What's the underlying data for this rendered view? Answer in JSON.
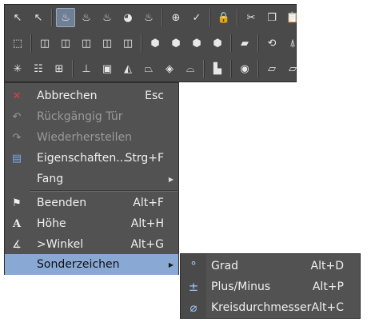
{
  "toolbar": {
    "row1": [
      {
        "icon": "cursor-arrow-icon",
        "glyph": "↖",
        "active": false
      },
      {
        "icon": "pick-arrow-icon",
        "glyph": "↖",
        "active": false
      },
      {
        "sep": true
      },
      {
        "icon": "bathtub-view-icon",
        "glyph": "♨",
        "active": true
      },
      {
        "icon": "bathtub-outline-icon",
        "glyph": "♨",
        "active": false
      },
      {
        "icon": "bathtub-render-icon",
        "glyph": "♨",
        "active": false
      },
      {
        "icon": "color-wheel-icon",
        "glyph": "◕",
        "active": false
      },
      {
        "icon": "bathtub-yellow-icon",
        "glyph": "♨",
        "active": false
      },
      {
        "sep": true
      },
      {
        "icon": "zoom-icon",
        "glyph": "⊕",
        "active": false
      },
      {
        "icon": "check-pen-icon",
        "glyph": "✓",
        "active": false
      },
      {
        "sep": true
      },
      {
        "icon": "lock-icon",
        "glyph": "🔒",
        "active": false
      },
      {
        "sep": true
      },
      {
        "icon": "cut-icon",
        "glyph": "✂",
        "active": false
      },
      {
        "icon": "copy-icon",
        "glyph": "❐",
        "active": false
      },
      {
        "icon": "paste-icon",
        "glyph": "📋",
        "active": false
      }
    ],
    "row2": [
      {
        "icon": "cube-axes-icon",
        "glyph": "⬚",
        "active": false
      },
      {
        "sep": true
      },
      {
        "icon": "cube-front-icon",
        "glyph": "◫",
        "active": false
      },
      {
        "icon": "cube-right-icon",
        "glyph": "◫",
        "active": false
      },
      {
        "icon": "cube-back-icon",
        "glyph": "◫",
        "active": false
      },
      {
        "icon": "cube-left-icon",
        "glyph": "◫",
        "active": false
      },
      {
        "icon": "cube-top-icon",
        "glyph": "◫",
        "active": false
      },
      {
        "sep": true
      },
      {
        "icon": "iso-cube-1-icon",
        "glyph": "⬢",
        "active": false
      },
      {
        "icon": "iso-cube-2-icon",
        "glyph": "⬢",
        "active": false
      },
      {
        "icon": "iso-cube-3-icon",
        "glyph": "⬢",
        "active": false
      },
      {
        "icon": "iso-cube-4-icon",
        "glyph": "⬢",
        "active": false
      },
      {
        "sep": true
      },
      {
        "icon": "plane-icon",
        "glyph": "▰",
        "active": false
      },
      {
        "sep": true
      },
      {
        "icon": "rotate-view-icon",
        "glyph": "⟲",
        "active": false
      },
      {
        "icon": "person-view-icon",
        "glyph": "⍋",
        "active": false
      }
    ],
    "row3": [
      {
        "icon": "sun-light-icon",
        "glyph": "✳",
        "active": false
      },
      {
        "icon": "stair-icon",
        "glyph": "☷",
        "active": false
      },
      {
        "icon": "grid-icon",
        "glyph": "⊞",
        "active": false
      },
      {
        "sep": true
      },
      {
        "icon": "layer-1-icon",
        "glyph": "⊥",
        "active": false
      },
      {
        "icon": "layer-2-icon",
        "glyph": "▣",
        "active": false
      },
      {
        "icon": "terrain-icon",
        "glyph": "◭",
        "active": false
      },
      {
        "icon": "slope-icon",
        "glyph": "⏢",
        "active": false
      },
      {
        "icon": "roof-icon",
        "glyph": "◈",
        "active": false
      },
      {
        "icon": "folder-open-icon",
        "glyph": "⌓",
        "active": false
      },
      {
        "sep": true
      },
      {
        "icon": "box-icon",
        "glyph": "▙",
        "active": false
      },
      {
        "sep": true
      },
      {
        "icon": "target-icon",
        "glyph": "◉",
        "active": false
      },
      {
        "sep": true
      },
      {
        "icon": "surface-icon",
        "glyph": "⏥",
        "active": false
      },
      {
        "icon": "surface-edit-icon",
        "glyph": "⏥",
        "active": false
      }
    ]
  },
  "menu": {
    "items": [
      {
        "name": "abbrechen",
        "icon": "cancel-x-icon",
        "glyph": "✕",
        "glyph_color": "#e04040",
        "label": "Abbrechen",
        "shortcut": "Esc",
        "disabled": false,
        "arrow": false,
        "highlight": false
      },
      {
        "name": "rueckgaengig",
        "icon": "undo-icon",
        "glyph": "↶",
        "glyph_color": "#9a9a9a",
        "label": "Rückgängig Tür",
        "shortcut": "",
        "disabled": true,
        "arrow": false,
        "highlight": false
      },
      {
        "name": "wiederherstellen",
        "icon": "redo-icon",
        "glyph": "↷",
        "glyph_color": "#9a9a9a",
        "label": "Wiederherstellen",
        "shortcut": "",
        "disabled": true,
        "arrow": false,
        "highlight": false
      },
      {
        "name": "eigenschaften",
        "icon": "properties-icon",
        "glyph": "▤",
        "glyph_color": "#7aa7e8",
        "label": "Eigenschaften...",
        "shortcut": "Strg+F",
        "disabled": false,
        "arrow": false,
        "highlight": false
      },
      {
        "name": "fang",
        "icon": "",
        "glyph": "",
        "glyph_color": "#ffffff",
        "label": "Fang",
        "shortcut": "",
        "disabled": false,
        "arrow": true,
        "highlight": false
      },
      {
        "name": "beenden",
        "icon": "finish-flag-icon",
        "glyph": "⚑",
        "glyph_color": "#f0f0f0",
        "label": "Beenden",
        "shortcut": "Alt+F",
        "disabled": false,
        "arrow": false,
        "highlight": false
      },
      {
        "name": "hoehe",
        "icon": "height-icon",
        "glyph": "A",
        "glyph_color": "#f0f0f0",
        "label": "Höhe",
        "shortcut": "Alt+H",
        "disabled": false,
        "arrow": false,
        "highlight": false
      },
      {
        "name": "winkel",
        "icon": "angle-icon",
        "glyph": "∡",
        "glyph_color": "#f0f0f0",
        "label": ">Winkel",
        "shortcut": "Alt+G",
        "disabled": false,
        "arrow": false,
        "highlight": false
      },
      {
        "name": "sonderzeichen",
        "icon": "",
        "glyph": "",
        "glyph_color": "#ffffff",
        "label": "Sonderzeichen",
        "shortcut": "",
        "disabled": false,
        "arrow": true,
        "highlight": true
      }
    ]
  },
  "submenu": {
    "items": [
      {
        "name": "grad",
        "icon": "degree-icon",
        "glyph": "°",
        "label": "Grad",
        "shortcut": "Alt+D"
      },
      {
        "name": "plus-minus",
        "icon": "plus-minus-icon",
        "glyph": "±",
        "label": "Plus/Minus",
        "shortcut": "Alt+P"
      },
      {
        "name": "kreisdurchmesser",
        "icon": "diameter-icon",
        "glyph": "⌀",
        "label": "Kreisdurchmesser",
        "shortcut": "Alt+C"
      }
    ]
  }
}
